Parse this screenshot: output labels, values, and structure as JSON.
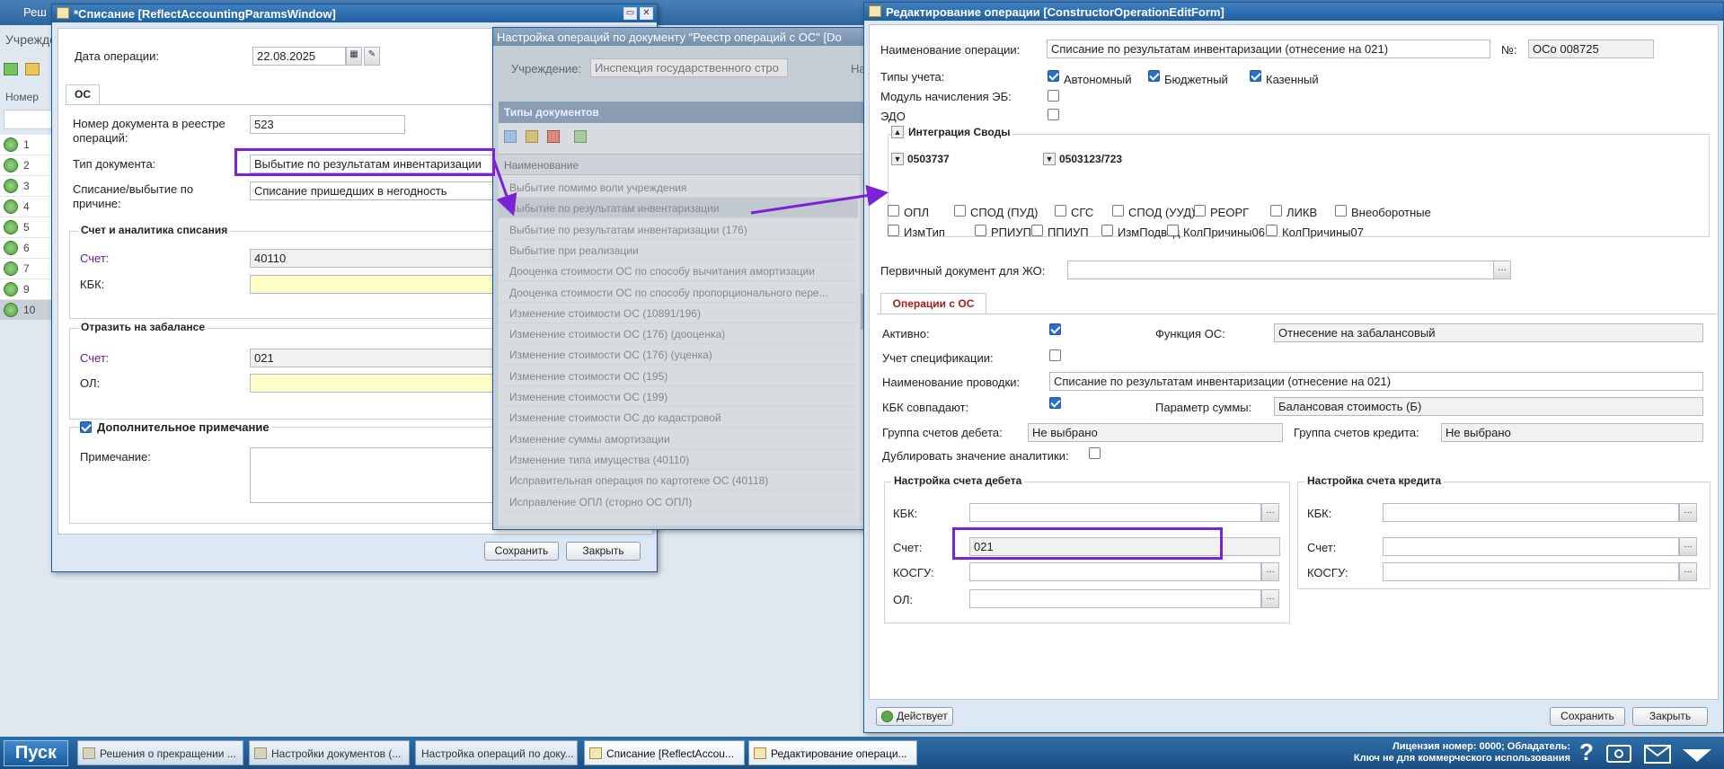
{
  "background": {
    "title": "Реш",
    "subtitle": "Учрежде",
    "column_header": "Номер",
    "rows": [
      "1",
      "2",
      "3",
      "4",
      "5",
      "6",
      "7",
      "9",
      "10"
    ]
  },
  "win1": {
    "title": "*Списание [ReflectAccountingParamsWindow]",
    "date_label": "Дата операции:",
    "date_value": "22.08.2025",
    "tab": "ОС",
    "doc_num_label": "Номер документа в реестре операций:",
    "doc_num_value": "523",
    "doc_type_label": "Тип документа:",
    "doc_type_value": "Выбытие по результатам инвентаризации",
    "reason_label": "Списание/выбытие по причине:",
    "reason_value": "Списание пришедших в негодность",
    "group1_title": "Счет и аналитика списания",
    "account_label": "Счет:",
    "account_value": "40110",
    "kbk_label": "КБК:",
    "group2_title": "Отразить на забалансе",
    "account2_label": "Счет:",
    "account2_value": "021",
    "ol_label": "ОЛ:",
    "note_group_title": "Дополнительное примечание",
    "note_label": "Примечание:",
    "save": "Сохранить",
    "close": "Закрыть"
  },
  "win2": {
    "title": "Настройка операций по документу \"Реестр операций с ОС\" [Do",
    "institution_label": "Учреждение:",
    "institution_value": "Инспекция государственного стро",
    "right_label": "На",
    "panel_title": "Типы документов",
    "column": "Наименование",
    "items": [
      "Выбытие помимо воли учреждения",
      "Выбытие по результатам инвентаризации",
      "Выбытие по результатам инвентаризации (176)",
      "Выбытие при реализации",
      "Дооценка стоимости ОС по способу вычитания амортизации",
      "Дооценка стоимости ОС по способу пропорционального пере...",
      "Изменение стоимости ОС (10891/196)",
      "Изменение стоимости ОС (176) (дооценка)",
      "Изменение стоимости ОС (176) (уценка)",
      "Изменение стоимости ОС (195)",
      "Изменение стоимости ОС (199)",
      "Изменение стоимости ОС до кадастровой",
      "Изменение суммы амортизации",
      "Изменение типа имущества (40110)",
      "Исправительная операция по картотеке ОС (40118)",
      "Исправление ОПЛ (сторно ОС ОПЛ)"
    ],
    "selected_index": 1
  },
  "win3": {
    "title": "Редактирование операции [ConstructorOperationEditForm]",
    "op_name_label": "Наименование операции:",
    "op_name_value": "Списание по результатам инвентаризации (отнесение на 021)",
    "num_label": "№:",
    "num_value": "ОСо 008725",
    "acc_types_label": "Типы учета:",
    "acc_types": [
      "Автономный",
      "Бюджетный",
      "Казенный"
    ],
    "eb_label": "Модуль начисления ЭБ:",
    "edo_label": "ЭДО",
    "integration_title": "Интеграция Своды",
    "form1": "0503737",
    "form2": "0503123/723",
    "checks_row1": [
      "ОПЛ",
      "СПОД (ПУД)",
      "СГС",
      "СПОД (УУД)",
      "РЕОРГ",
      "ЛИКВ",
      "Внеоборотные"
    ],
    "checks_row2": [
      "ИзмТип",
      "РПИУП",
      "ППИУП",
      "ИзмПодвед",
      "КолПричины06",
      "КолПричины07"
    ],
    "primary_doc_label": "Первичный документ для ЖО:",
    "tab": "Операции с ОС",
    "active_label": "Активно:",
    "function_label": "Функция ОС:",
    "function_value": "Отнесение на забалансовый",
    "spec_label": "Учет спецификации:",
    "posting_label": "Наименование проводки:",
    "posting_value": "Списание по результатам инвентаризации (отнесение на 021)",
    "kbk_match_label": "КБК совпадают:",
    "sum_param_label": "Параметр суммы:",
    "sum_param_value": "Балансовая стоимость (Б)",
    "debit_group_label": "Группа счетов дебета:",
    "debit_group_value": "Не выбрано",
    "credit_group_label": "Группа счетов кредита:",
    "credit_group_value": "Не выбрано",
    "dup_label": "Дублировать значение аналитики:",
    "debit_title": "Настройка счета дебета",
    "credit_title": "Настройка счета кредита",
    "kbk_label": "КБК:",
    "account_label": "Счет:",
    "kosgu_label": "КОСГУ:",
    "ol_label": "ОЛ:",
    "debit_account_value": "021",
    "status_button": "Действует",
    "save": "Сохранить",
    "close": "Закрыть"
  },
  "taskbar": {
    "start": "Пуск",
    "items": [
      "Решения о прекращении ...",
      "Настройки документов (...",
      "Настройка операций по доку...",
      "Списание [ReflectAccou...",
      "Редактирование операци..."
    ],
    "license_line1": "Лицензия номер: 0000; Обладатель:",
    "license_line2": "Ключ не для коммерческого использования",
    "help": "?"
  },
  "colors": {
    "highlight": "#7b22d6",
    "title_bar": "#215f9e",
    "required_field": "#ffffc8"
  }
}
